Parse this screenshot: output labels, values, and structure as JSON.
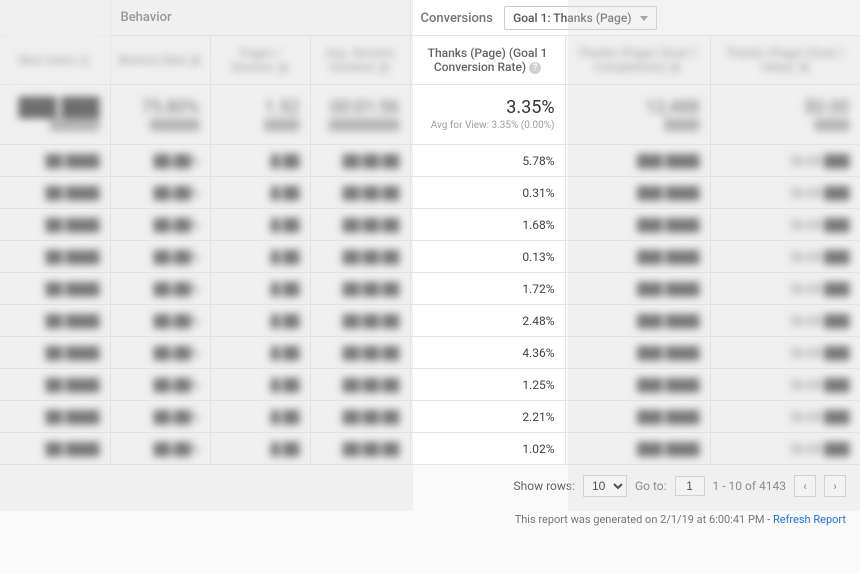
{
  "group_headers": {
    "behavior": "Behavior",
    "conversions": "Conversions",
    "goal_select": "Goal 1: Thanks (Page)"
  },
  "columns": {
    "new_users": "New Users",
    "bounce_rate": "Bounce Rate",
    "pages_session": "Pages / Session",
    "avg_session": "Avg. Session Duration",
    "goal_conv": "Thanks (Page) (Goal 1 Conversion Rate)",
    "goal_comp": "Thanks (Page) (Goal 1 Completions)",
    "goal_value": "Thanks (Page) (Goal 1 Value)"
  },
  "summary": {
    "conv_rate": "3.35%",
    "conv_sub": "Avg for View: 3.35% (0.00%)"
  },
  "rows": [
    {
      "conv": "5.78%"
    },
    {
      "conv": "0.31%"
    },
    {
      "conv": "1.68%"
    },
    {
      "conv": "0.13%"
    },
    {
      "conv": "1.72%"
    },
    {
      "conv": "2.48%"
    },
    {
      "conv": "4.36%"
    },
    {
      "conv": "1.25%"
    },
    {
      "conv": "2.21%"
    },
    {
      "conv": "1.02%"
    }
  ],
  "footer": {
    "show_rows_label": "Show rows:",
    "show_rows_value": "10",
    "goto_label": "Go to:",
    "goto_value": "1",
    "range": "1 - 10 of 4143"
  },
  "report_gen": {
    "text": "This report was generated on 2/1/19 at 6:00:41 PM - ",
    "link": "Refresh Report"
  },
  "placeholders": {
    "b0": "███ ███",
    "b1": "75.80%",
    "b2": "1.52",
    "b3": "00:01:56",
    "b4": "12,488",
    "b5": "$0.00",
    "s1": "███████",
    "s2": "█████",
    "s3": "██████████"
  }
}
